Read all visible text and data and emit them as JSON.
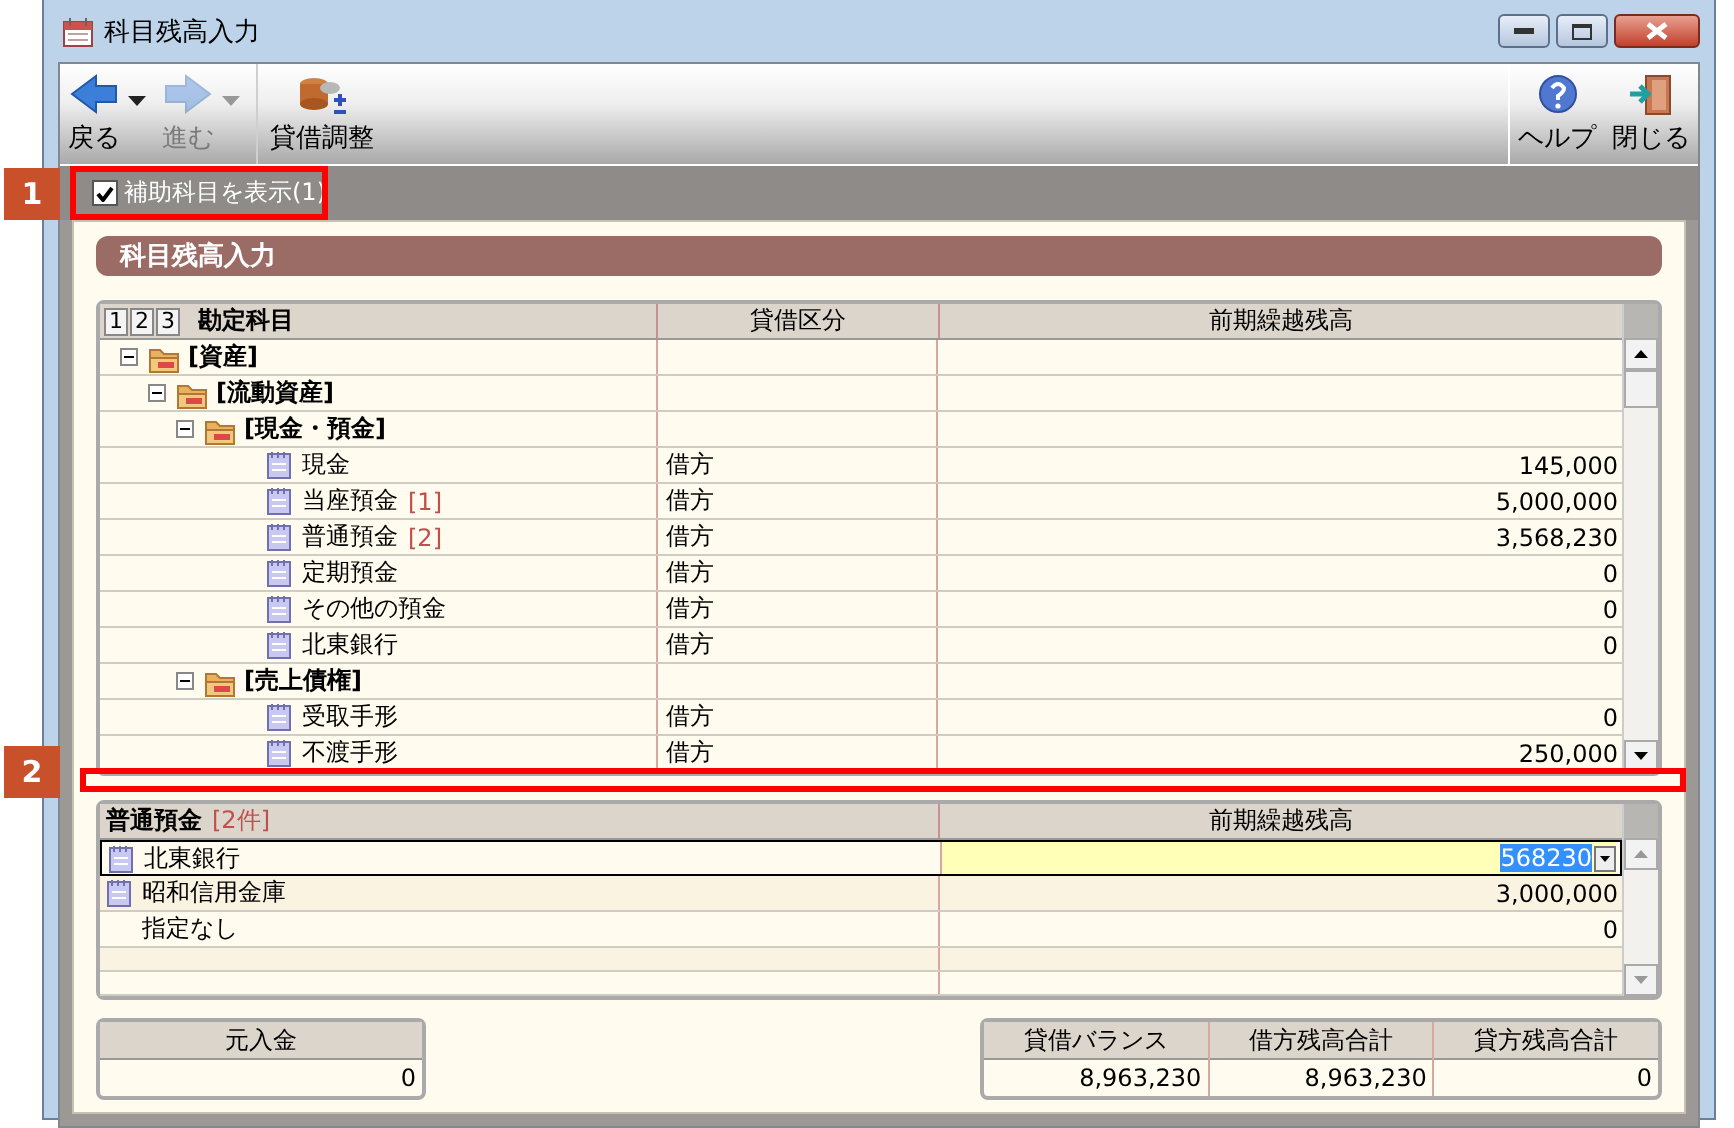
{
  "window": {
    "title": "科目残高入力"
  },
  "toolbar": {
    "left": [
      {
        "kind": "back",
        "label": "戻る",
        "disabled": false,
        "dropdown": true
      },
      {
        "kind": "forward",
        "label": "進む",
        "disabled": true,
        "dropdown": true
      },
      {
        "kind": "adjust",
        "label": "貸借調整",
        "disabled": false,
        "dropdown": false
      }
    ],
    "right": [
      {
        "kind": "help",
        "label": "ヘルプ",
        "disabled": false,
        "dropdown": false
      },
      {
        "kind": "close",
        "label": "閉じる",
        "disabled": false,
        "dropdown": false
      }
    ]
  },
  "option": {
    "label": "補助科目を表示(1)",
    "checked": true
  },
  "panel_title": "科目残高入力",
  "main_table": {
    "level_buttons": [
      "1",
      "2",
      "3"
    ],
    "columns": [
      "勘定科目",
      "貸借区分",
      "前期繰越残高"
    ],
    "rows": [
      {
        "kind": "group",
        "name": "[資産]",
        "expanded": true,
        "children": [
          {
            "kind": "group",
            "name": "[流動資産]",
            "expanded": true,
            "children": [
              {
                "kind": "group",
                "name": "[現金・預金]",
                "expanded": true,
                "children": [
                  {
                    "kind": "account",
                    "name": "現金",
                    "side": "借方",
                    "balance": "145,000"
                  },
                  {
                    "kind": "account",
                    "name": "当座預金",
                    "tag": "[1]",
                    "side": "借方",
                    "balance": "5,000,000"
                  },
                  {
                    "kind": "account",
                    "name": "普通預金",
                    "tag": "[2]",
                    "side": "借方",
                    "balance": "3,568,230"
                  },
                  {
                    "kind": "account",
                    "name": "定期預金",
                    "side": "借方",
                    "balance": "0"
                  },
                  {
                    "kind": "account",
                    "name": "その他の預金",
                    "side": "借方",
                    "balance": "0"
                  },
                  {
                    "kind": "account",
                    "name": "北東銀行",
                    "side": "借方",
                    "balance": "0"
                  }
                ]
              },
              {
                "kind": "group",
                "name": "[売上債権]",
                "expanded": true,
                "children": [
                  {
                    "kind": "account",
                    "name": "受取手形",
                    "side": "借方",
                    "balance": "0"
                  },
                  {
                    "kind": "account",
                    "name": "不渡手形",
                    "side": "借方",
                    "balance": "250,000"
                  }
                ]
              }
            ]
          }
        ]
      }
    ]
  },
  "sub_table": {
    "title": "普通預金",
    "count": "[2件]",
    "column": "前期繰越残高",
    "rows": [
      {
        "kind": "account",
        "name": "北東銀行",
        "value": "568230",
        "selected": true
      },
      {
        "kind": "account",
        "name": "昭和信用金庫",
        "balance": "3,000,000",
        "selected": false
      },
      {
        "kind": "none",
        "name": "指定なし",
        "balance": "0",
        "selected": false
      }
    ]
  },
  "capital": {
    "label": "元入金",
    "value": "0"
  },
  "totals": [
    {
      "label": "貸借バランス",
      "value": "8,963,230"
    },
    {
      "label": "借方残高合計",
      "value": "8,963,230"
    },
    {
      "label": "貸方残高合計",
      "value": "0"
    }
  ],
  "annotations": [
    {
      "number": "1"
    },
    {
      "number": "2"
    }
  ]
}
